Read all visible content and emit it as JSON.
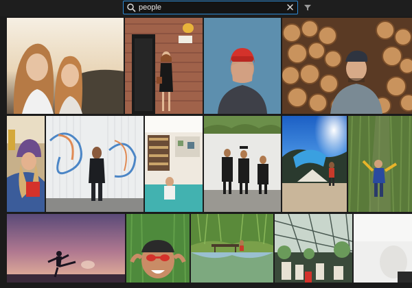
{
  "search": {
    "value": "people",
    "placeholder": "Search"
  },
  "icons": {
    "search": "magnifier-icon",
    "clear": "close-icon",
    "filter": "filter-icon"
  },
  "colors": {
    "accent": "#2e8bd6",
    "background": "#1b1b1b"
  },
  "photos": [
    "two-women-sunset",
    "woman-black-door-116",
    "man-red-beanie-blue-wall",
    "man-logs-stack",
    "woman-purple-beanie",
    "man-graffiti-wall",
    "cafe-interior",
    "group-white-wall",
    "tent-blue-sky",
    "person-lying-grass",
    "silhouette-kick-dusk",
    "man-red-glasses-grass",
    "park-reflection",
    "greenhouse-market",
    "white-tile"
  ]
}
